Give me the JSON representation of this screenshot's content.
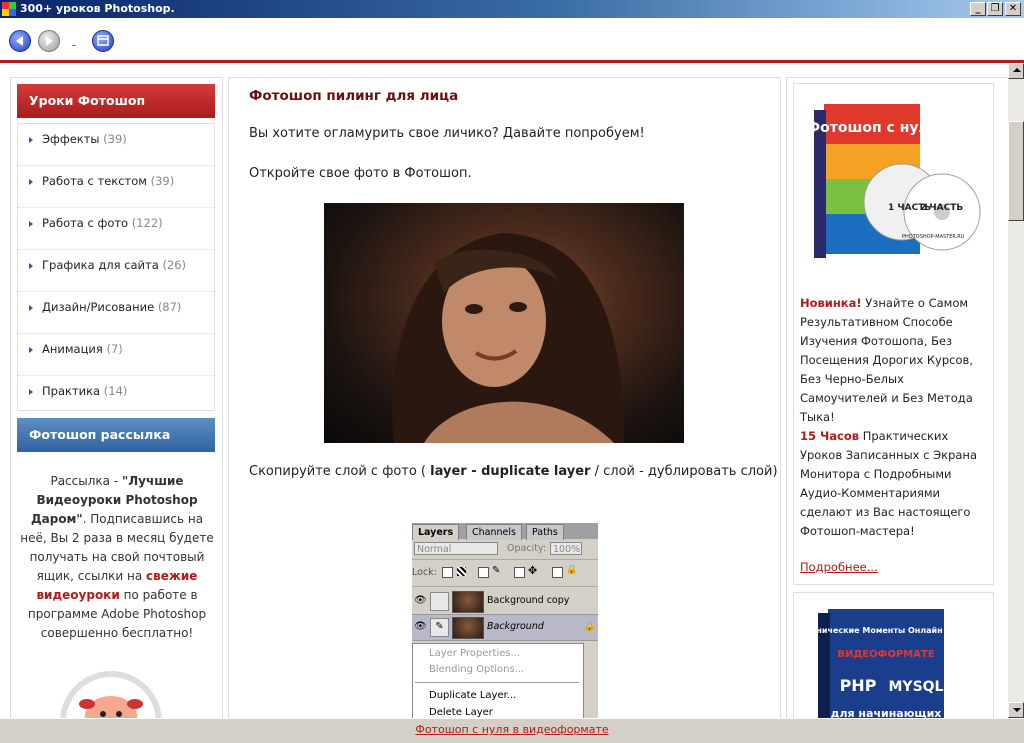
{
  "window": {
    "title": "300+ уроков Photoshop.",
    "minimize": "_",
    "restore": "❐",
    "close": "✕"
  },
  "toolbar": {
    "separator": "-"
  },
  "left": {
    "categories_title": "Уроки Фотошоп",
    "categories": [
      {
        "label": "Эффекты",
        "count": "(39)"
      },
      {
        "label": "Работа с текстом",
        "count": "(39)"
      },
      {
        "label": "Работа с фото",
        "count": "(122)"
      },
      {
        "label": "Графика для сайта",
        "count": "(26)"
      },
      {
        "label": "Дизайн/Рисование",
        "count": "(87)"
      },
      {
        "label": "Анимация",
        "count": "(7)"
      },
      {
        "label": "Практика",
        "count": "(14)"
      }
    ],
    "newsletter_title": "Фотошоп рассылка",
    "newsletter": {
      "t1": "Рассылка - ",
      "b1": "\"Лучшие Видеоуроки Photoshop Даром\"",
      "t2": ". Подписавшись на неё, Вы 2 раза в месяц будете получать на свой почтовый ящик, ссылки на ",
      "r1": "свежие видеоуроки",
      "t3": " по работе в программе Adobe Photoshop совершенно бесплатно!"
    }
  },
  "article": {
    "title": "Фотошоп пилинг для лица",
    "p1": "Вы хотите огламурить свое личико? Давайте попробуем!",
    "p2": "Откройте свое фото в Фотошоп.",
    "p3_start": "Скопируйте слой с фото ( ",
    "p3_bold": "layer - duplicate layer",
    "p3_end": " / слой - дублировать слой)"
  },
  "layers_panel": {
    "tabs": [
      "Layers",
      "Channels",
      "Paths"
    ],
    "blend_mode": "Normal",
    "opacity_label": "Opacity:",
    "opacity_value": "100%",
    "lock_label": "Lock:",
    "layers": [
      {
        "name": "Background copy"
      },
      {
        "name": "Background"
      }
    ],
    "menu": [
      {
        "label": "Layer Properties..."
      },
      {
        "label": "Blending Options..."
      },
      {
        "label": "Duplicate Layer..."
      },
      {
        "label": "Delete Layer"
      }
    ]
  },
  "right": {
    "promo1": {
      "dvd_title": "Фотошоп с нуля",
      "disc1_label": "1 ЧАСТЬ",
      "disc2_label": "2 ЧАСТЬ",
      "brand": "PHOTOSHOP-MASTER.RU",
      "hl1": "Новинка!",
      "t1": " Узнайте о Самом Результативном Способе Изучения Фотошопа, Без Посещения Дорогих Курсов, Без Черно-Белых Самоучителей и Без Метода Тыка!",
      "hl2": "15 Часов",
      "t2": " Практических Уроков Записанных с Экрана Монитора с Подробными Аудио-Комментариями сделают из Вас настоящего Фотошоп-мастера!",
      "more": "Подробнее..."
    },
    "promo2": {
      "top": "Все Технические Моменты Онлайн Бизнеса в",
      "mid": "ВИДЕОФОРМАТЕ",
      "php": "PHP",
      "mysql": "MYSQL",
      "bottom": "для начинающих"
    }
  },
  "status": {
    "link": "Фотошоп с нуля в видеоформате"
  },
  "colors": {
    "accent_red": "#b01c1c",
    "header_blue": "#2f63a0",
    "title_bar": "#0a246a"
  }
}
